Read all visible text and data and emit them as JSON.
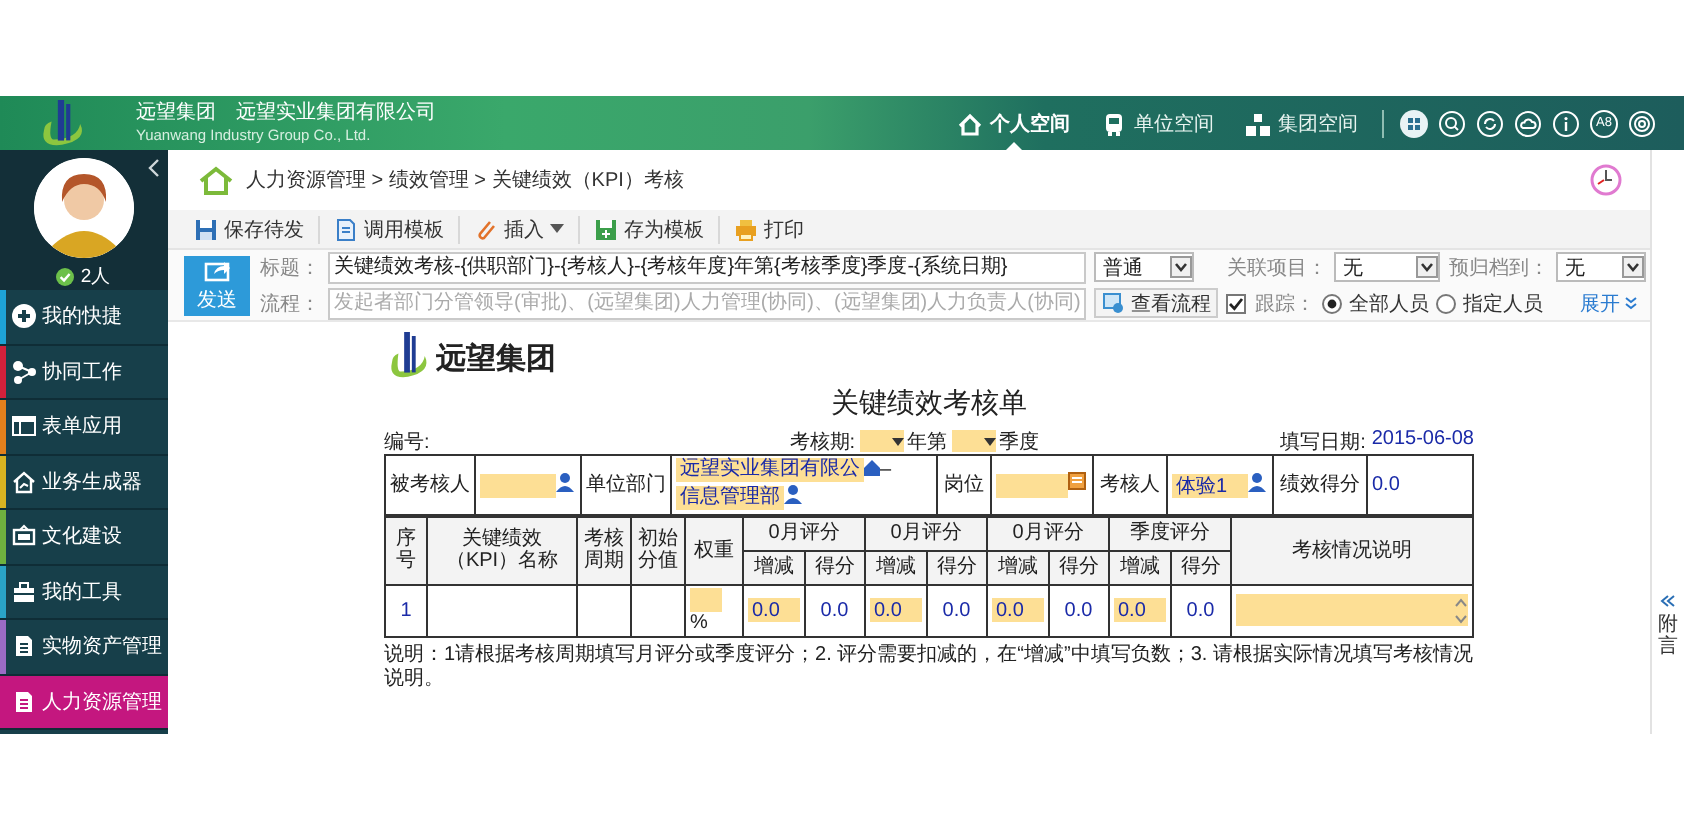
{
  "header": {
    "brand": "远望集团",
    "company": "远望实业集团有限公司",
    "company_en": "Yuanwang Industry Group Co., Ltd.",
    "nav": [
      {
        "label": "个人空间",
        "selected": true
      },
      {
        "label": "单位空间",
        "selected": false
      },
      {
        "label": "集团空间",
        "selected": false
      }
    ],
    "badge_tool": "A8"
  },
  "sidebar": {
    "online": "2人",
    "items": [
      {
        "label": "我的快捷",
        "color": "#1ea3d6",
        "selected": false
      },
      {
        "label": "协同工作",
        "color": "#d3213b",
        "selected": false
      },
      {
        "label": "表单应用",
        "color": "#e2801c",
        "selected": false
      },
      {
        "label": "业务生成器",
        "color": "#d8b321",
        "selected": false
      },
      {
        "label": "文化建设",
        "color": "#6fb13f",
        "selected": false
      },
      {
        "label": "我的工具",
        "color": "#2aa3c6",
        "selected": false
      },
      {
        "label": "实物资产管理",
        "color": "#9b6bc4",
        "selected": false
      },
      {
        "label": "人力资源管理",
        "color": "#c4177f",
        "selected": true
      }
    ]
  },
  "breadcrumb": "人力资源管理 > 绩效管理 > 关键绩效（KPI）考核",
  "toolbar": [
    {
      "label": "保存待发",
      "kind": "save",
      "dropdown": false
    },
    {
      "label": "调用模板",
      "kind": "template",
      "dropdown": false
    },
    {
      "label": "插入",
      "kind": "insert",
      "dropdown": true
    },
    {
      "label": "存为模板",
      "kind": "save-template",
      "dropdown": false
    },
    {
      "label": "打印",
      "kind": "print",
      "dropdown": false
    }
  ],
  "compose": {
    "send": "发送",
    "title_label": "标题：",
    "title_value": "关键绩效考核-{供职部门}-{考核人}-{考核年度}年第{考核季度}季度-{系统日期}",
    "importance": "普通",
    "related_label": "关联项目：",
    "related_value": "无",
    "archive_label": "预归档到：",
    "archive_value": "无",
    "flow_label": "流程：",
    "flow_placeholder": "发起者部门分管领导(审批)、(远望集团)人力管理(协同)、(远望集团)人力负责人(协同)",
    "view_flow": "查看流程",
    "track_label": "跟踪：",
    "track_checked": true,
    "track_options": [
      {
        "label": "全部人员",
        "selected": true
      },
      {
        "label": "指定人员",
        "selected": false
      }
    ],
    "expand": "展开"
  },
  "document": {
    "brand": "远望集团",
    "title": "关键绩效考核单",
    "number_label": "编号:",
    "period_label": "考核期:",
    "year_suffix": "年第",
    "quarter_suffix": "季度",
    "date_label": "填写日期:",
    "date_value": "2015-06-08",
    "info": {
      "assessee_label": "被考核人",
      "dept_label": "单位部门",
      "company_value": "远望实业集团有限公",
      "dept_sep": "–",
      "dept_value": "信息管理部",
      "post_label": "岗位",
      "assessor_label": "考核人",
      "assessor_value": "体验1",
      "score_label": "绩效得分",
      "score_value": "0.0"
    },
    "columns": [
      "序号",
      "关键绩效（KPI）名称",
      "考核周期",
      "初始分值",
      "权重"
    ],
    "score_groups": [
      {
        "label": "0月评分",
        "sub_columns": [
          "增减",
          "得分"
        ]
      },
      {
        "label": "0月评分",
        "sub_columns": [
          "增减",
          "得分"
        ]
      },
      {
        "label": "0月评分",
        "sub_columns": [
          "增减",
          "得分"
        ]
      },
      {
        "label": "季度评分",
        "sub_columns": [
          "增减",
          "得分"
        ]
      }
    ],
    "notes_column": "考核情况说明",
    "rows": [
      {
        "index": "1",
        "weight_unit": "%",
        "scores": [
          {
            "change": "0.0",
            "score": "0.0"
          },
          {
            "change": "0.0",
            "score": "0.0"
          },
          {
            "change": "0.0",
            "score": "0.0"
          },
          {
            "change": "0.0",
            "score": "0.0"
          }
        ]
      }
    ],
    "note": "说明：1请根据考核周期填写月评分或季度评分；2. 评分需要扣减的，在“增减”中填写负数；3. 请根据实际情况填写考核情况说明。"
  },
  "side_tab": {
    "label": "附言"
  }
}
